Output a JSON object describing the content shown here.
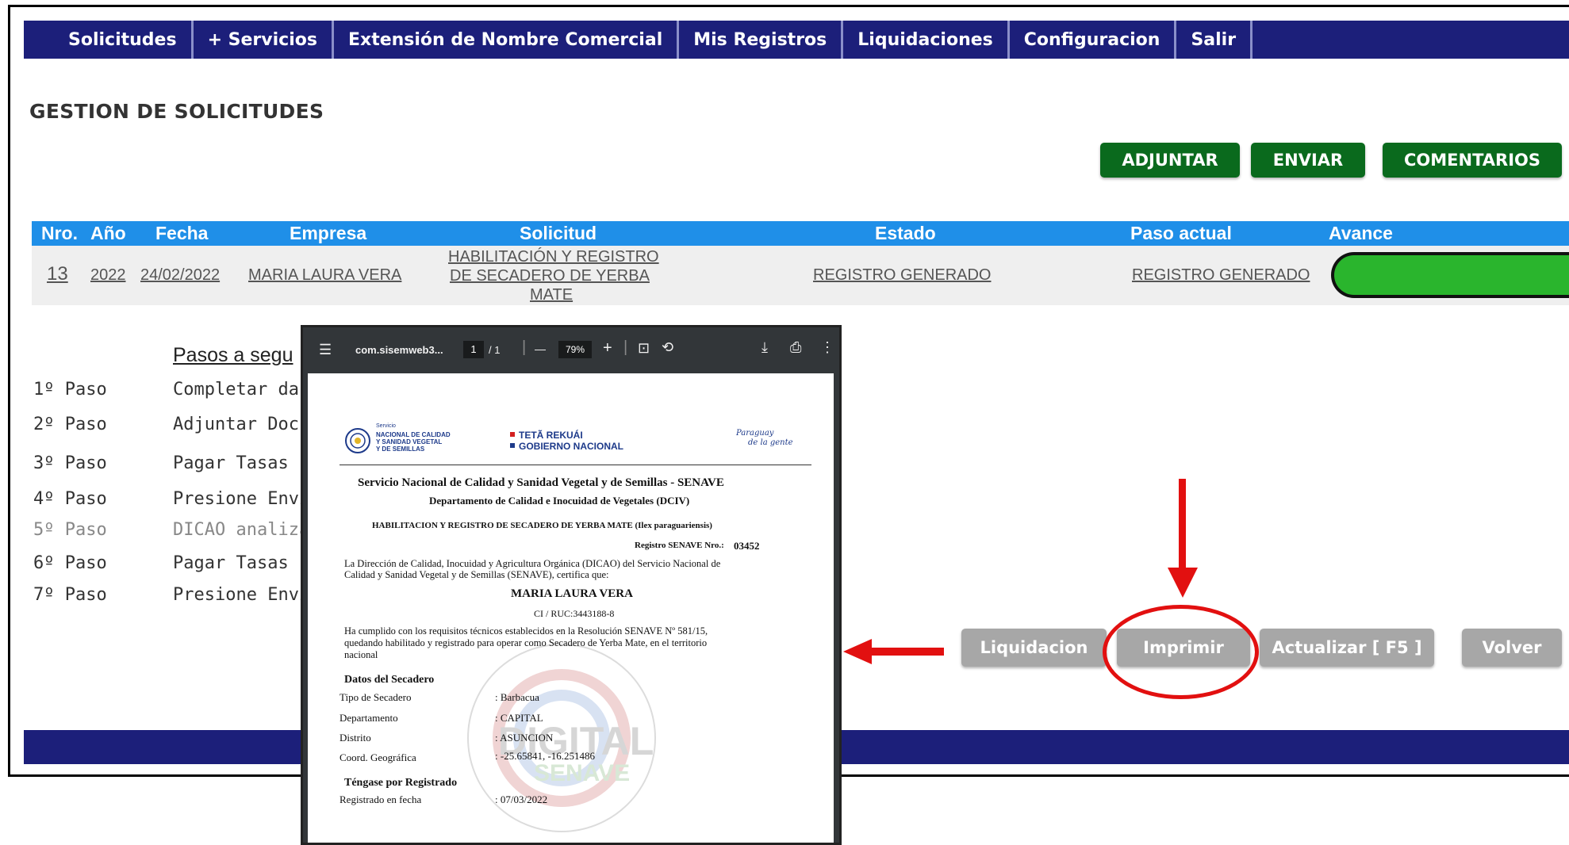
{
  "nav": {
    "items": [
      "Solicitudes",
      "+ Servicios",
      "Extensión de Nombre Comercial",
      "Mis Registros",
      "Liquidaciones",
      "Configuracion",
      "Salir"
    ]
  },
  "page": {
    "title": "GESTION DE SOLICITUDES"
  },
  "actions": {
    "adjuntar": "ADJUNTAR",
    "enviar": "ENVIAR",
    "comentarios": "COMENTARIOS"
  },
  "table": {
    "headers": {
      "nro": "Nro.",
      "anio": "Año",
      "fecha": "Fecha",
      "empresa": "Empresa",
      "solicitud": "Solicitud",
      "estado": "Estado",
      "paso": "Paso actual",
      "avance": "Avance"
    },
    "row": {
      "nro": "13",
      "anio": "2022",
      "fecha": "24/02/2022",
      "empresa": "MARIA LAURA VERA",
      "solicitud_l1": "HABILITACIÓN Y REGISTRO",
      "solicitud_l2": "DE SECADERO DE YERBA",
      "solicitud_l3": "MATE",
      "estado": "REGISTRO GENERADO",
      "paso": "REGISTRO GENERADO",
      "avance_fraction": 1.0
    }
  },
  "steps": {
    "title": "Pasos a segu",
    "items": [
      {
        "label": "1º Paso",
        "text": "Completar da"
      },
      {
        "label": "2º Paso",
        "text": "Adjuntar Docu"
      },
      {
        "label": "3º Paso",
        "text": "Pagar Tasas (S"
      },
      {
        "label": "4º Paso",
        "text": "Presione Envi"
      },
      {
        "label": "5º Paso",
        "text": "DICAO analiza"
      },
      {
        "label": "6º Paso",
        "text": "Pagar Tasas (R"
      },
      {
        "label": "7º Paso",
        "text": "Presione Envi"
      }
    ]
  },
  "bottom_buttons": {
    "liquidacion": "Liquidacion",
    "imprimir": "Imprimir",
    "actualizar": "Actualizar [ F5 ]",
    "volver": "Volver"
  },
  "pdf": {
    "filename": "com.sisemweb3...",
    "page_current": "1",
    "page_total": "/ 1",
    "zoom": "79%",
    "minus": "—",
    "plus": "+",
    "header": {
      "senave_small": "Servicio",
      "senave_l1": "NACIONAL DE CALIDAD",
      "senave_l2": "Y SANIDAD VEGETAL",
      "senave_l3": "Y DE SEMILLAS",
      "gov_l1": "TETÃ REKUÁI",
      "gov_l2": "GOBIERNO NACIONAL",
      "slogan_l1": "Paraguay",
      "slogan_l2": "de la gente"
    },
    "institution": "Servicio Nacional de Calidad y Sanidad Vegetal y de Semillas - SENAVE",
    "department": "Departamento de Calidad e Inocuidad de Vegetales (DCIV)",
    "doc_title": "HABILITACION Y REGISTRO DE SECADERO DE YERBA MATE (Ilex paraguariensis)",
    "registro_label": "Registro SENAVE Nro.:",
    "registro_nro": "03452",
    "intro_l1": "La Dirección de Calidad, Inocuidad y Agricultura Orgánica (DICAO) del Servicio Nacional de",
    "intro_l2": "Calidad y Sanidad Vegetal y de Semillas (SENAVE), certifica que:",
    "holder": "MARIA LAURA VERA",
    "ruc": "CI / RUC:3443188-8",
    "body_l1": "Ha cumplido con los requisitos técnicos establecidos en la Resolución SENAVE Nº 581/15,",
    "body_l2": "quedando habilitado y registrado para operar como Secadero de Yerba Mate, en el territorio",
    "body_l3": "nacional",
    "datos_title": "Datos del Secadero",
    "datos": [
      {
        "k": "Tipo de Secadero",
        "v": ": Barbacua"
      },
      {
        "k": "Departamento",
        "v": ": CAPITAL"
      },
      {
        "k": "Distrito",
        "v": ": ASUNCION"
      },
      {
        "k": "Coord. Geográfica",
        "v": ": -25.65841, -16.251486"
      }
    ],
    "tengase": "Téngase por Registrado",
    "reg_fecha_k": "Registrado en fecha",
    "reg_fecha_v": ": 07/03/2022",
    "watermark_main": "DIGITAL",
    "watermark_sub": "SENAVE"
  },
  "colors": {
    "nav_bg": "#1c1f7a",
    "table_head": "#1f8fe8",
    "green_button": "#0a6a1d",
    "gray_button": "#a7a7a7",
    "progress": "#2ab52d",
    "annotation": "#e21010"
  }
}
